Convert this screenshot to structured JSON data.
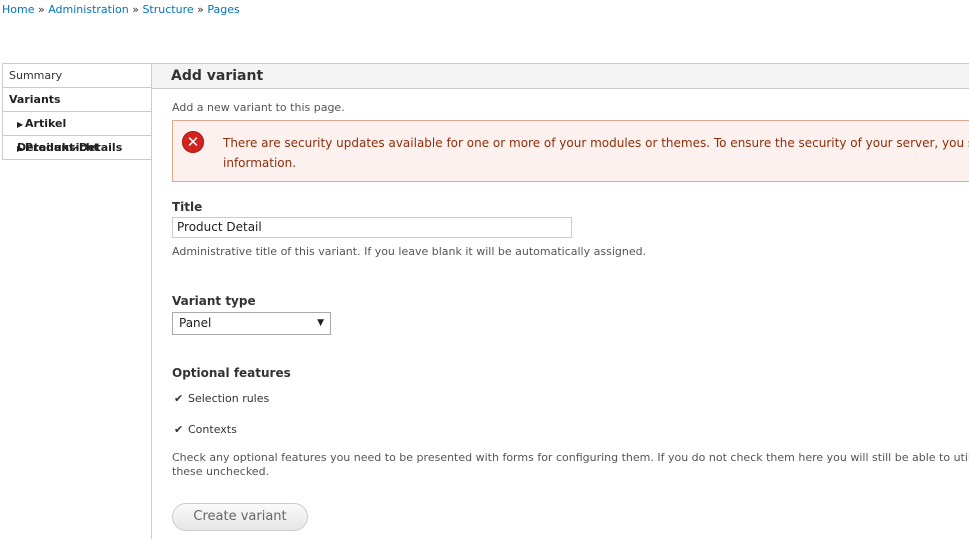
{
  "breadcrumb": [
    "Home",
    "Administration",
    "Structure",
    "Pages"
  ],
  "breadcrumb_separator": "»",
  "tabs": {
    "summary": "Summary",
    "variants": "Variants",
    "sub": [
      "Artikel Detailansicht",
      "Produkt-Details"
    ]
  },
  "main": {
    "heading": "Add variant",
    "description": "Add a new variant to this page.",
    "alert": {
      "line1": "There are security updates available for one or more of your modules or themes. To ensure the security of your server, you shoul",
      "line2": "information.",
      "icon_glyph": "✕"
    },
    "title_label": "Title",
    "title_value": "Product Detail",
    "title_help": "Administrative title of this variant. If you leave blank it will be automatically assigned.",
    "variant_type_label": "Variant type",
    "variant_type_value": "Panel",
    "optional_label": "Optional features",
    "features": [
      "Selection rules",
      "Contexts"
    ],
    "features_help_line1": "Check any optional features you need to be presented with forms for configuring them. If you do not check them here you will still be able to utilize th",
    "features_help_line2": "these unchecked.",
    "submit_label": "Create variant"
  },
  "colors": {
    "link": "#0074bd",
    "alert_bg": "#fcf1ee",
    "alert_border": "#e1a98d",
    "alert_text": "#8c2e0b",
    "error_icon": "#d2241e"
  }
}
